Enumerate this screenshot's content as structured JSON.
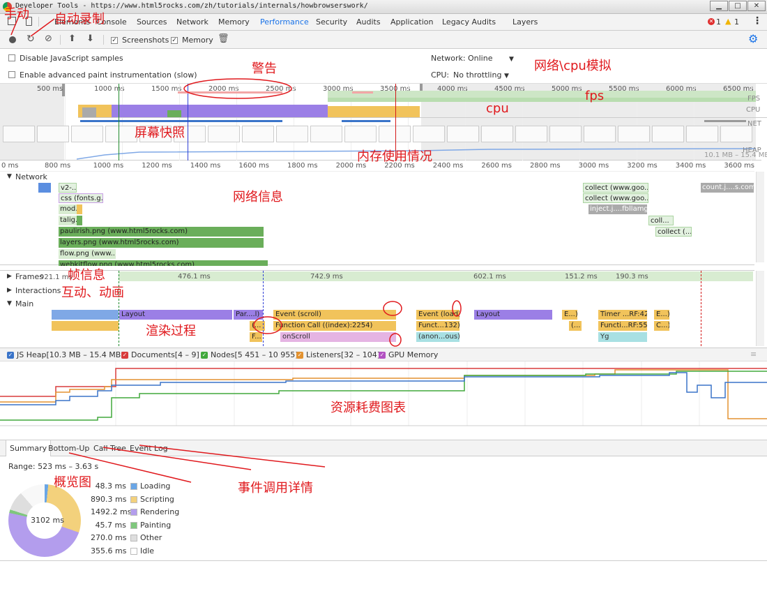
{
  "window": {
    "title": "Developer Tools - https://www.html5rocks.com/zh/tutorials/internals/howbrowserswork/"
  },
  "tabs": [
    "Elements",
    "Console",
    "Sources",
    "Network",
    "Memory",
    "Performance",
    "Security",
    "Audits",
    "Application",
    "Legacy Audits",
    "Layers"
  ],
  "status": {
    "errors": "1",
    "warnings": "1"
  },
  "toolbar": {
    "screenshots": "Screenshots",
    "memory": "Memory"
  },
  "settings": {
    "disable_js": "Disable JavaScript samples",
    "advanced_paint": "Enable advanced paint instrumentation (slow)",
    "network_label": "Network:",
    "network_value": "Online",
    "cpu_label": "CPU:",
    "cpu_value": "No throttling"
  },
  "overview": {
    "ticks": [
      "500 ms",
      "1000 ms",
      "1500 ms",
      "2000 ms",
      "2500 ms",
      "3000 ms",
      "3500 ms",
      "4000 ms",
      "4500 ms",
      "5000 ms",
      "5500 ms",
      "6000 ms",
      "6500 ms"
    ],
    "lanes": [
      "FPS",
      "CPU",
      "NET",
      "HEAP"
    ],
    "heap": "10.1 MB – 15.4 MB"
  },
  "detail_ticks": [
    "0 ms",
    "800 ms",
    "1000 ms",
    "1200 ms",
    "1400 ms",
    "1600 ms",
    "1800 ms",
    "2000 ms",
    "2200 ms",
    "2400 ms",
    "2600 ms",
    "2800 ms",
    "3000 ms",
    "3200 ms",
    "3400 ms",
    "3600 ms"
  ],
  "network": {
    "title": "Network",
    "requests": [
      "v2-...",
      "css (fonts.g...",
      "mod...",
      "talig...",
      "paulirish.png (www.html5rocks.com)",
      "layers.png (www.html5rocks.com)",
      "flow.png (www....",
      "webkitflow.png (www.html5rocks.com)",
      "collect (www.goo...",
      "collect (www.goo...",
      "inject.j....fbllamg)",
      "coll...",
      "collect (...",
      "count.j....s.com)"
    ]
  },
  "frames": {
    "label": "Frames",
    "first": "921.1 ms",
    "values": [
      "476.1 ms",
      "742.9 ms",
      "602.1 ms",
      "151.2 ms",
      "190.3 ms"
    ]
  },
  "interactions": "Interactions",
  "main": {
    "label": "Main",
    "row1": [
      "Layout",
      "Par....l)",
      "Event (scroll)",
      "Event (load)",
      "Layout",
      "E...)",
      "Timer ...RF:42)",
      "E...)"
    ],
    "row2": [
      "(...",
      "Function Call ((index):2254)",
      "Funct...132)",
      "(...",
      "Functi...RF:55)",
      "C...)"
    ],
    "row3": [
      "F...",
      "onScroll",
      "(anon...ous)",
      "Yg"
    ]
  },
  "memory_legend": [
    {
      "label": "JS Heap[10.3 MB – 15.4 MB]",
      "color": "#3a74c9"
    },
    {
      "label": "Documents[4 – 9]",
      "color": "#d83b3b"
    },
    {
      "label": "Nodes[5 451 – 10 955]",
      "color": "#41a83c"
    },
    {
      "label": "Listeners[32 – 104]",
      "color": "#e39230"
    },
    {
      "label": "GPU Memory",
      "color": "#b352c2"
    }
  ],
  "summary": {
    "tabs": [
      "Summary",
      "Bottom-Up",
      "Call Tree",
      "Event Log"
    ],
    "range": "Range: 523 ms – 3.63 s",
    "total": "3102 ms",
    "rows": [
      {
        "value": "48.3 ms",
        "label": "Loading",
        "color": "#6aa6e6"
      },
      {
        "value": "890.3 ms",
        "label": "Scripting",
        "color": "#f3d17c"
      },
      {
        "value": "1492.2 ms",
        "label": "Rendering",
        "color": "#b39ded"
      },
      {
        "value": "45.7 ms",
        "label": "Painting",
        "color": "#7fc77d"
      },
      {
        "value": "270.0 ms",
        "label": "Other",
        "color": "#dedede"
      },
      {
        "value": "355.6 ms",
        "label": "Idle",
        "color": "#ffffff"
      }
    ]
  },
  "annotations": {
    "manual": "手动",
    "auto_record": "自动录制",
    "warning": "警告",
    "net_cpu_sim": "网络\\cpu模拟",
    "fps": "fps",
    "cpu": "cpu",
    "screenshot": "屏幕快照",
    "memory_usage": "内存使用情况",
    "network_info": "网络信息",
    "frame_info": "帧信息",
    "interaction": "互动、动画",
    "render": "渲染过程",
    "resource_chart": "资源耗费图表",
    "overview_chart": "概览图",
    "event_detail": "事件调用详情"
  }
}
